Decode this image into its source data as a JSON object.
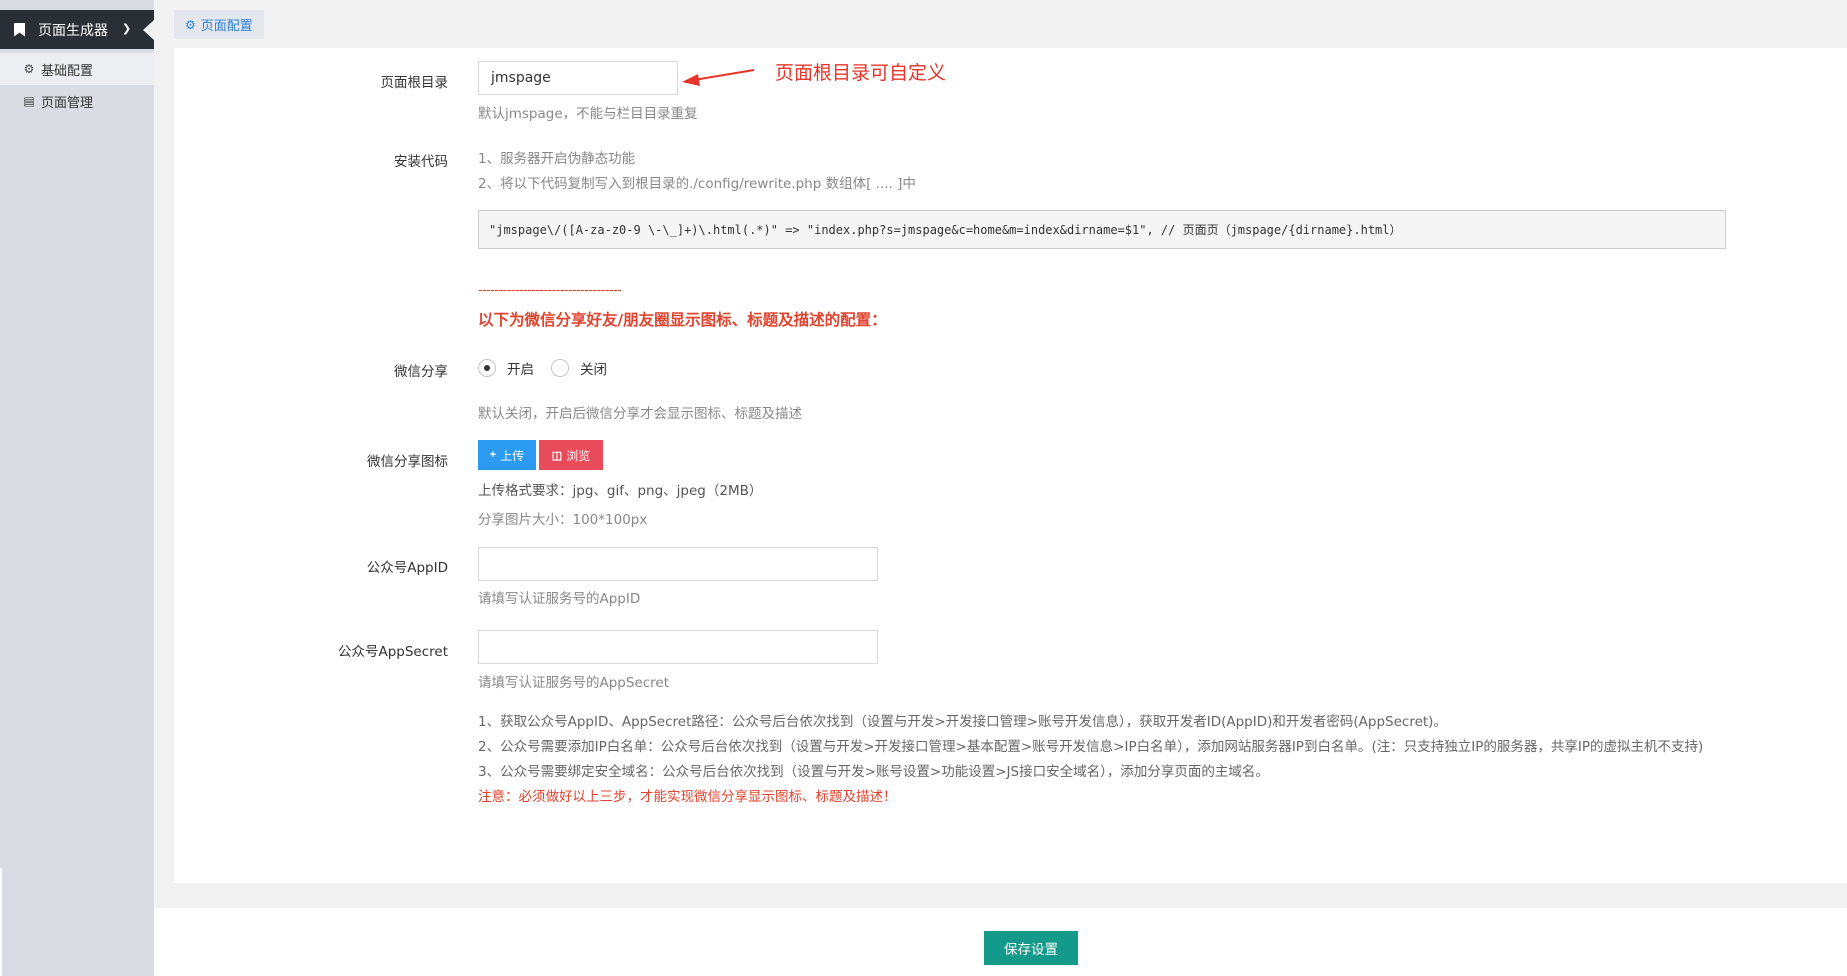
{
  "sidebar": {
    "header_title": "页面生成器",
    "items": [
      {
        "label": "基础配置",
        "icon": "gear-icon"
      },
      {
        "label": "页面管理",
        "icon": "book-icon"
      }
    ]
  },
  "tab": {
    "label": "页面配置",
    "icon": "gear-icon"
  },
  "form": {
    "root_dir": {
      "label": "页面根目录",
      "value": "jmspage",
      "help": "默认jmspage，不能与栏目目录重复",
      "annotation": "页面根目录可自定义"
    },
    "install_code": {
      "label": "安装代码",
      "step1": "1、服务器开启伪静态功能",
      "step2": "2、将以下代码复制写入到根目录的./config/rewrite.php 数组体[ .... ]中",
      "code": "\"jmspage\\/([A-za-z0-9 \\-\\_]+)\\.html(.*)\" => \"index.php?s=jmspage&c=home&m=index&dirname=$1\", // 页面页（jmspage/{dirname}.html）"
    },
    "divider": "-----------------------------------",
    "wechat_heading": "以下为微信分享好友/朋友圈显示图标、标题及描述的配置：",
    "wechat_share": {
      "label": "微信分享",
      "options": [
        "开启",
        "关闭"
      ],
      "selected": "开启",
      "help": "默认关闭，开启后微信分享才会显示图标、标题及描述"
    },
    "wechat_icon": {
      "label": "微信分享图标",
      "upload_label": "上传",
      "browse_label": "浏览",
      "format_req": "上传格式要求：jpg、gif、png、jpeg（2MB）",
      "size_req": "分享图片大小：100*100px"
    },
    "appid": {
      "label": "公众号AppID",
      "value": "",
      "help": "请填写认证服务号的AppID"
    },
    "appsecret": {
      "label": "公众号AppSecret",
      "value": "",
      "help": "请填写认证服务号的AppSecret"
    },
    "notes": [
      "1、获取公众号AppID、AppSecret路径：公众号后台依次找到（设置与开发>开发接口管理>账号开发信息），获取开发者ID(AppID)和开发者密码(AppSecret)。",
      "2、公众号需要添加IP白名单：公众号后台依次找到（设置与开发>开发接口管理>基本配置>账号开发信息>IP白名单），添加网站服务器IP到白名单。(注：只支持独立IP的服务器，共享IP的虚拟主机不支持)",
      "3、公众号需要绑定安全域名：公众号后台依次找到（设置与开发>账号设置>功能设置>JS接口安全域名），添加分享页面的主域名。"
    ],
    "warning": "注意：必须做好以上三步，才能实现微信分享显示图标、标题及描述！"
  },
  "footer": {
    "save_label": "保存设置"
  },
  "colors": {
    "sidebar_dark": "#2a2f36",
    "accent_blue": "#2d7fd1",
    "warning_red": "#e0442f",
    "save_green": "#139a8a",
    "upload_blue": "#2a9bf0",
    "browse_red": "#e84b5a"
  }
}
